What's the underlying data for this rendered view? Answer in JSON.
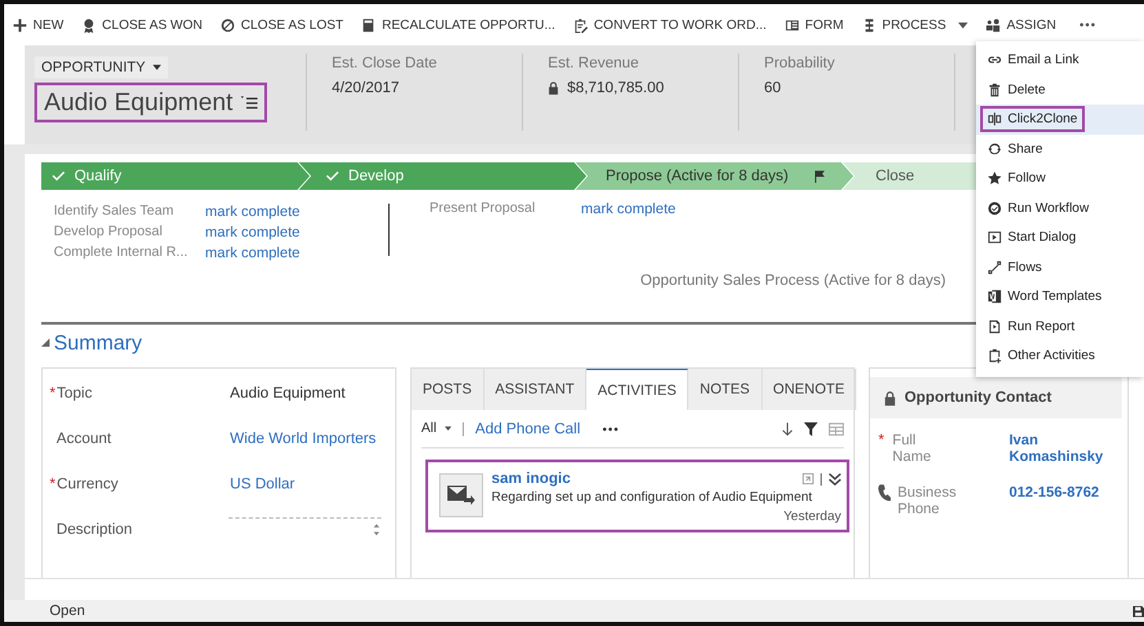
{
  "toolbar": {
    "items": [
      {
        "label": "NEW",
        "dropdown": false
      },
      {
        "label": "CLOSE AS WON",
        "dropdown": false
      },
      {
        "label": "CLOSE AS LOST",
        "dropdown": false
      },
      {
        "label": "RECALCULATE OPPORTU...",
        "dropdown": false
      },
      {
        "label": "CONVERT TO WORK ORD...",
        "dropdown": false
      },
      {
        "label": "FORM",
        "dropdown": false
      },
      {
        "label": "PROCESS",
        "dropdown": true
      },
      {
        "label": "ASSIGN",
        "dropdown": false
      }
    ],
    "more": "•••"
  },
  "header": {
    "entity": "OPPORTUNITY",
    "title": "Audio Equipment",
    "title_highlighted": true,
    "fields": [
      {
        "label": "Est. Close Date",
        "value": "4/20/2017",
        "locked": false
      },
      {
        "label": "Est. Revenue",
        "value": "$8,710,785.00",
        "locked": true
      },
      {
        "label": "Probability",
        "value": "60",
        "locked": false
      }
    ],
    "required_mark": "*"
  },
  "process": {
    "stages": [
      {
        "label": "Qualify",
        "done": true,
        "active": false
      },
      {
        "label": "Develop",
        "done": true,
        "active": false
      },
      {
        "label": "Propose (Active for 8 days)",
        "done": false,
        "active": true
      },
      {
        "label": "Close",
        "done": false,
        "active": false
      }
    ],
    "step_groups": [
      {
        "steps": [
          {
            "label": "Identify Sales Team",
            "action": "mark complete"
          },
          {
            "label": "Develop Proposal",
            "action": "mark complete"
          },
          {
            "label": "Complete Internal R...",
            "action": "mark complete"
          }
        ]
      },
      {
        "steps": [
          {
            "label": "Present Proposal",
            "action": "mark complete"
          }
        ]
      }
    ],
    "caption": "Opportunity Sales Process (Active for 8 days)"
  },
  "summary": {
    "title": "Summary",
    "expanded": true,
    "fields": [
      {
        "label": "Topic",
        "value": "Audio Equipment",
        "required": true,
        "kind": "text"
      },
      {
        "label": "Account",
        "value": "Wide World Importers",
        "required": false,
        "kind": "link"
      },
      {
        "label": "Currency",
        "value": "US Dollar",
        "required": true,
        "kind": "link"
      },
      {
        "label": "Description",
        "required": false,
        "kind": "textarea"
      }
    ]
  },
  "activities": {
    "tabs": [
      {
        "label": "POSTS",
        "selected": false
      },
      {
        "label": "ASSISTANT",
        "selected": false
      },
      {
        "label": "ACTIVITIES",
        "selected": true
      },
      {
        "label": "NOTES",
        "selected": false
      },
      {
        "label": "ONENOTE",
        "selected": false
      }
    ],
    "filter": "All",
    "add_action": "Add Phone Call",
    "more": "•••",
    "items": [
      {
        "title": "sam inogic",
        "text": "Regarding set up and configuration of Audio Equipment",
        "time": "Yesterday",
        "highlighted": true
      }
    ]
  },
  "contact": {
    "title": "Opportunity Contact",
    "fields": [
      {
        "label": "Full Name",
        "value": "Ivan Komashinsky",
        "required": true,
        "kind": "name"
      },
      {
        "label": "Business Phone",
        "value": "012-156-8762",
        "required": false,
        "kind": "phone"
      }
    ]
  },
  "footer": {
    "status": "Open"
  },
  "menu": {
    "items": [
      {
        "label": "Email a Link",
        "selected": false,
        "highlighted": false
      },
      {
        "label": "Delete",
        "selected": false,
        "highlighted": false
      },
      {
        "label": "Click2Clone",
        "selected": true,
        "highlighted": true
      },
      {
        "label": "Share",
        "selected": false,
        "highlighted": false
      },
      {
        "label": "Follow",
        "selected": false,
        "highlighted": false
      },
      {
        "label": "Run Workflow",
        "selected": false,
        "highlighted": false
      },
      {
        "label": "Start Dialog",
        "selected": false,
        "highlighted": false
      },
      {
        "label": "Flows",
        "selected": false,
        "highlighted": false
      },
      {
        "label": "Word Templates",
        "selected": false,
        "highlighted": false
      },
      {
        "label": "Run Report",
        "selected": false,
        "highlighted": false
      },
      {
        "label": "Other Activities",
        "selected": false,
        "highlighted": false
      }
    ]
  }
}
